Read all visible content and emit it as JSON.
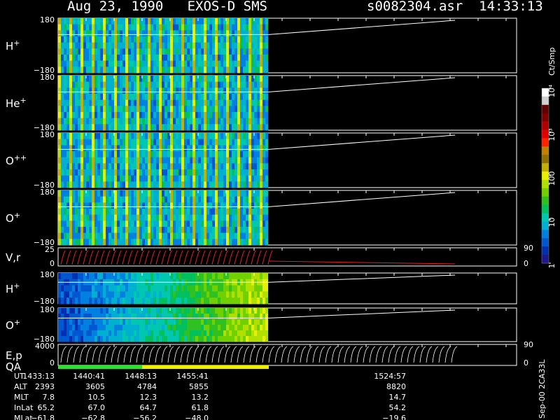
{
  "header": {
    "title": "Aug 23, 1990   EXOS-D SMS",
    "file": "s0082304.asr  14:33:13"
  },
  "colorbar": {
    "unit": "Ct/Smp",
    "ticks": [
      {
        "label": "1",
        "value": 1
      },
      {
        "label": "10",
        "value": 10
      },
      {
        "label": "100",
        "value": 100
      },
      {
        "label": "10³",
        "value": 1000
      },
      {
        "label": "10⁴",
        "value": 10000
      }
    ],
    "colors": [
      "#1a1a8c",
      "#0030b0",
      "#0058d0",
      "#0080e0",
      "#00b0d0",
      "#00c8b0",
      "#00c060",
      "#30c020",
      "#70d000",
      "#b0e000",
      "#e8f000",
      "#c0b000",
      "#907000",
      "#c08000",
      "#ff2000",
      "#e00000",
      "#b00000",
      "#800000",
      "#600000",
      "#d0d0d0",
      "#ffffff"
    ]
  },
  "footer_id": "Sep-00 2CA33L",
  "ut_labels": {
    "rows": [
      "UT",
      "ALT",
      "MLT",
      "InLat",
      "MLat"
    ]
  },
  "ut_columns": [
    {
      "UT": "1433:13",
      "ALT": "2393",
      "MLT": "7.8",
      "InLat": "65.2",
      "MLat": "−61.8"
    },
    {
      "UT": "1440:41",
      "ALT": "3605",
      "MLT": "10.5",
      "InLat": "67.0",
      "MLat": "−62.8"
    },
    {
      "UT": "1448:13",
      "ALT": "4784",
      "MLT": "12.3",
      "InLat": "64.7",
      "MLat": "−56.2"
    },
    {
      "UT": "1455:41",
      "ALT": "5855",
      "MLT": "13.2",
      "InLat": "61.8",
      "MLat": "−48.0"
    },
    {
      "UT": "1524:57",
      "ALT": "8820",
      "MLT": "14.7",
      "InLat": "54.2",
      "MLat": "−19.6"
    }
  ],
  "chart_data": {
    "type": "heatmap",
    "panels": [
      {
        "label": "H",
        "sup": "+",
        "ytop": "180",
        "ybot": "−180",
        "ylim": [
          -180,
          180
        ]
      },
      {
        "label": "He",
        "sup": "+",
        "ytop": "180",
        "ybot": "−180",
        "ylim": [
          -180,
          180
        ]
      },
      {
        "label": "O",
        "sup": "++",
        "ytop": "180",
        "ybot": "−180",
        "ylim": [
          -180,
          180
        ]
      },
      {
        "label": "O",
        "sup": "+",
        "ytop": "180",
        "ybot": "−180",
        "ylim": [
          -180,
          180
        ]
      },
      {
        "label": "V,r",
        "sup": "",
        "ytop": "25",
        "ybot": "0",
        "ylim": [
          0,
          25
        ],
        "right_ticks": [
          "90",
          "0"
        ]
      },
      {
        "label": "H",
        "sup": "+",
        "ytop": "180",
        "ybot": "−180",
        "ylim": [
          -180,
          180
        ]
      },
      {
        "label": "O",
        "sup": "+",
        "ytop": "180",
        "ybot": "−180",
        "ylim": [
          -180,
          180
        ]
      },
      {
        "label": "E,p",
        "label2": "QA",
        "sup": "",
        "ytop": "4000",
        "ybot": "0",
        "ylim": [
          0,
          4000
        ],
        "right_ticks": [
          "90",
          "0"
        ]
      }
    ],
    "data_end_fraction": 0.46,
    "colorbar_range": [
      1,
      10000
    ],
    "colorbar_scale": "log"
  }
}
